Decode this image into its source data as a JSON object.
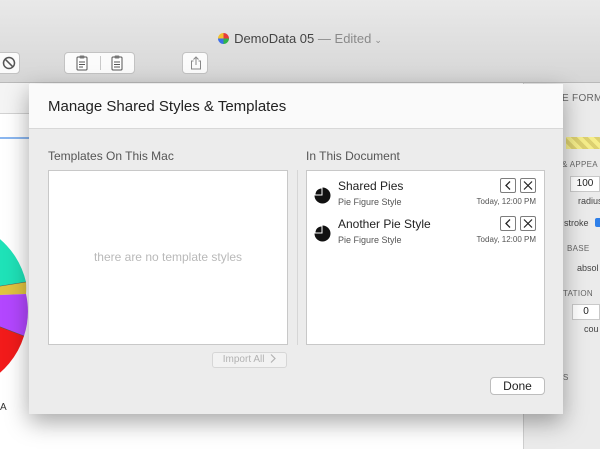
{
  "window": {
    "title": "DemoData 05",
    "title_status": "— Edited",
    "title_chevron": "⌄"
  },
  "toolbar": {
    "icons": [
      "no-entry-icon",
      "clipboard-copy-icon",
      "clipboard-paste-icon",
      "share-icon"
    ]
  },
  "background": {
    "corner_letter": "A"
  },
  "inspector": {
    "section_format": "E FORM",
    "section_appearance": "& APPEA",
    "radius_value": "100",
    "radius_label": "radius",
    "stroke_label": "stroke",
    "section_base": "BASE",
    "base_value": "absol",
    "section_rotation": "TATION",
    "rotation_value": "0",
    "rotation_label": "cou",
    "section_s": "S"
  },
  "sheet": {
    "title": "Manage Shared Styles & Templates",
    "left_heading": "Templates On This Mac",
    "right_heading": "In This Document",
    "empty_message": "there are no template styles",
    "import_button": "Import All",
    "done_button": "Done",
    "items": [
      {
        "name": "Shared Pies",
        "subtitle": "Pie Figure Style",
        "date": "Today, 12:00 PM"
      },
      {
        "name": "Another Pie Style",
        "subtitle": "Pie Figure Style",
        "date": "Today, 12:00 PM"
      }
    ]
  },
  "colors": {
    "accent": "#2f7fe8",
    "pie_teal": "#1fe2b8",
    "pie_purple": "#b347ff",
    "pie_red": "#f21b1b"
  }
}
